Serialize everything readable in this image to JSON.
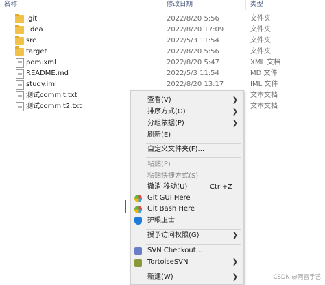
{
  "header": {
    "name": "名称",
    "date": "修改日期",
    "type": "类型"
  },
  "files": [
    {
      "name": ".git",
      "date": "2022/8/20 5:56",
      "type": "文件夹",
      "kind": "folder"
    },
    {
      "name": ".idea",
      "date": "2022/8/20 17:09",
      "type": "文件夹",
      "kind": "folder"
    },
    {
      "name": "src",
      "date": "2022/5/3 11:54",
      "type": "文件夹",
      "kind": "folder"
    },
    {
      "name": "target",
      "date": "2022/8/20 5:56",
      "type": "文件夹",
      "kind": "folder"
    },
    {
      "name": "pom.xml",
      "date": "2022/8/20 5:47",
      "type": "XML 文档",
      "kind": "file"
    },
    {
      "name": "README.md",
      "date": "2022/5/3 11:54",
      "type": "MD 文件",
      "kind": "file"
    },
    {
      "name": "study.iml",
      "date": "2022/8/20 13:17",
      "type": "IML 文件",
      "kind": "file"
    },
    {
      "name": "测试commit.txt",
      "date": "",
      "type": "文本文档",
      "kind": "file"
    },
    {
      "name": "测试commit2.txt",
      "date": "",
      "type": "文本文档",
      "kind": "file"
    }
  ],
  "menu": {
    "view": "查看(V)",
    "sort": "排序方式(O)",
    "group": "分组依据(P)",
    "refresh": "刷新(E)",
    "customize": "自定义文件夹(F)...",
    "paste": "粘贴(P)",
    "paste_shortcut": "粘贴快捷方式(S)",
    "undo_move": "撤消 移动(U)",
    "undo_shortcut": "Ctrl+Z",
    "git_gui": "Git GUI Here",
    "git_bash": "Git Bash Here",
    "protect": "护眼卫士",
    "grant_access": "授予访问权限(G)",
    "svn_checkout": "SVN Checkout...",
    "tortoise_svn": "TortoiseSVN",
    "new": "新建(W)"
  },
  "watermark": "CSDN @阿雷手艺",
  "colors": {
    "highlight_border": "#e0262b",
    "folder": "#f0c24a"
  }
}
